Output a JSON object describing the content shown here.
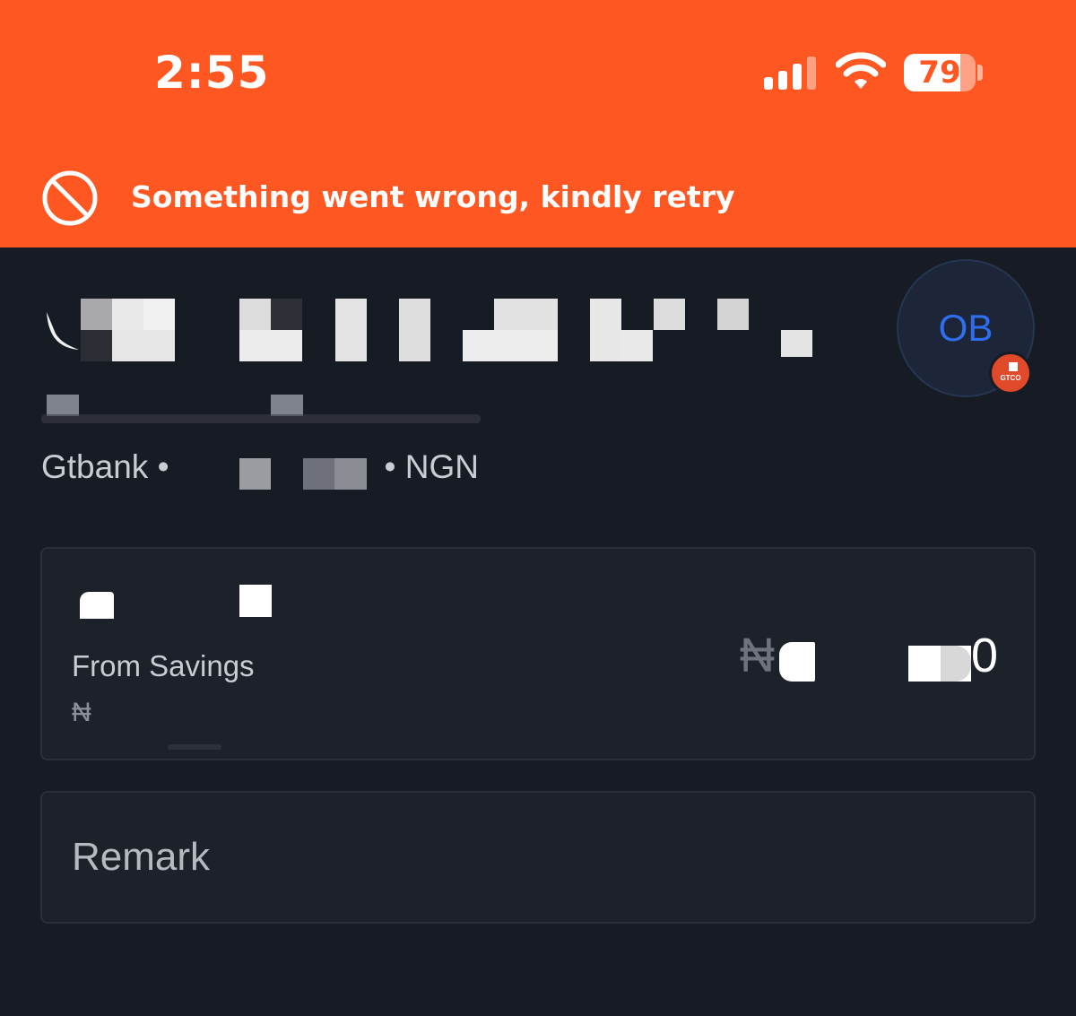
{
  "status_bar": {
    "time": "2:55",
    "battery_percent": "79",
    "battery_level": 0.79,
    "signal_bars_active": 3,
    "signal_bars_total": 4
  },
  "banner": {
    "message": "Something went wrong, kindly retry",
    "icon": "prohibited-icon",
    "background_color": "#fe5722"
  },
  "recipient": {
    "avatar_initials": "OB",
    "bank_badge_label": "GTCO",
    "bank_name": "Gtbank •",
    "currency_suffix": "• NGN"
  },
  "source": {
    "label": "From Savings",
    "balance_currency": "₦",
    "amount_currency": "₦",
    "amount_tail": "0"
  },
  "remark": {
    "placeholder": "Remark"
  },
  "colors": {
    "background": "#171b23",
    "card": "#1d2129",
    "accent_blue": "#2f6ef0"
  }
}
